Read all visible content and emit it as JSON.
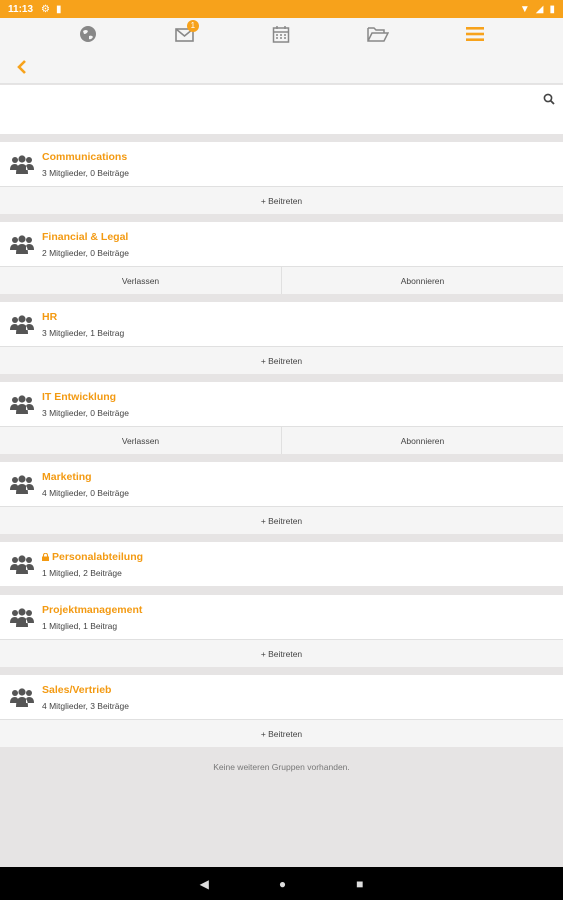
{
  "status": {
    "time": "11:13"
  },
  "topnav": {
    "messages_badge": "1"
  },
  "search": {
    "placeholder": ""
  },
  "groups": [
    {
      "name": "Communications",
      "meta": "3 Mitglieder, 0 Beiträge",
      "locked": false,
      "actions": [
        "+ Beitreten"
      ]
    },
    {
      "name": "Financial & Legal",
      "meta": "2 Mitglieder, 0 Beiträge",
      "locked": false,
      "actions": [
        "Verlassen",
        "Abonnieren"
      ]
    },
    {
      "name": "HR",
      "meta": "3 Mitglieder, 1 Beitrag",
      "locked": false,
      "actions": [
        "+ Beitreten"
      ]
    },
    {
      "name": "IT Entwicklung",
      "meta": "3 Mitglieder, 0 Beiträge",
      "locked": false,
      "actions": [
        "Verlassen",
        "Abonnieren"
      ]
    },
    {
      "name": "Marketing",
      "meta": "4 Mitglieder, 0 Beiträge",
      "locked": false,
      "actions": [
        "+ Beitreten"
      ]
    },
    {
      "name": "Personalabteilung",
      "meta": "1 Mitglied, 2 Beiträge",
      "locked": true,
      "actions": []
    },
    {
      "name": "Projektmanagement",
      "meta": "1 Mitglied, 1 Beitrag",
      "locked": false,
      "actions": [
        "+ Beitreten"
      ]
    },
    {
      "name": "Sales/Vertrieb",
      "meta": "4 Mitglieder, 3 Beiträge",
      "locked": false,
      "actions": [
        "+ Beitreten"
      ]
    }
  ],
  "footer": {
    "message": "Keine weiteren Gruppen vorhanden."
  },
  "colors": {
    "accent": "#f7a21b",
    "link": "#f39a12"
  }
}
